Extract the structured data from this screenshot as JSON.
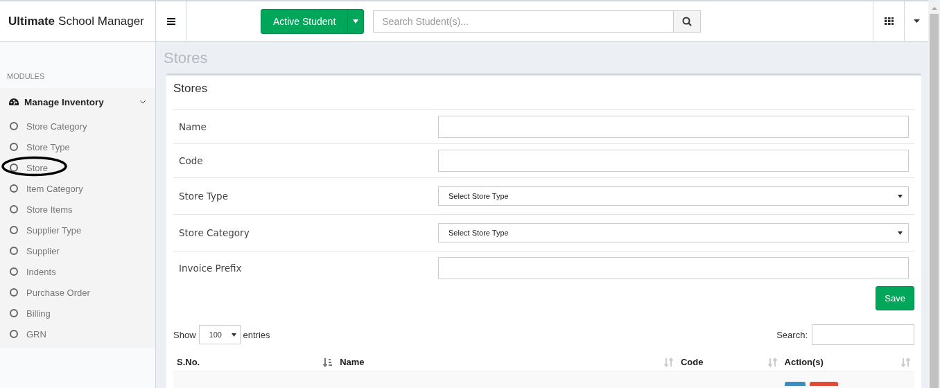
{
  "header": {
    "brand_bold": "Ultimate",
    "brand_rest": "School Manager",
    "student_button": "Active Student",
    "search": {
      "placeholder": "Search Student(s)..."
    }
  },
  "sidebar": {
    "heading": "MODULES",
    "group": {
      "label": "Manage Inventory",
      "expanded": true,
      "items": [
        {
          "label": "Store Category",
          "circled": false
        },
        {
          "label": "Store Type",
          "circled": false
        },
        {
          "label": "Store",
          "circled": true
        },
        {
          "label": "Item Category",
          "circled": false
        },
        {
          "label": "Store Items",
          "circled": false
        },
        {
          "label": "Supplier Type",
          "circled": false
        },
        {
          "label": "Supplier",
          "circled": false
        },
        {
          "label": "Indents",
          "circled": false
        },
        {
          "label": "Purchase Order",
          "circled": false
        },
        {
          "label": "Billing",
          "circled": false
        },
        {
          "label": "GRN",
          "circled": false
        }
      ]
    }
  },
  "page_title": "Stores",
  "card": {
    "title": "Stores",
    "fields": [
      {
        "label": "Name",
        "kind": "text"
      },
      {
        "label": "Code",
        "kind": "text"
      },
      {
        "label": "Store Type",
        "kind": "select",
        "value": "Select Store Type"
      },
      {
        "label": "Store Category",
        "kind": "select",
        "value": "Select Store Type"
      },
      {
        "label": "Invoice Prefix",
        "kind": "text"
      }
    ],
    "save": "Save"
  },
  "table": {
    "show": "Show",
    "page_size": "100",
    "entries": "entries",
    "search_label": "Search:",
    "columns": [
      {
        "label": "S.No.",
        "sorted": true
      },
      {
        "label": "Name",
        "sorted": false
      },
      {
        "label": "Code",
        "sorted": false
      },
      {
        "label": "Action(s)",
        "sorted": false
      }
    ]
  }
}
